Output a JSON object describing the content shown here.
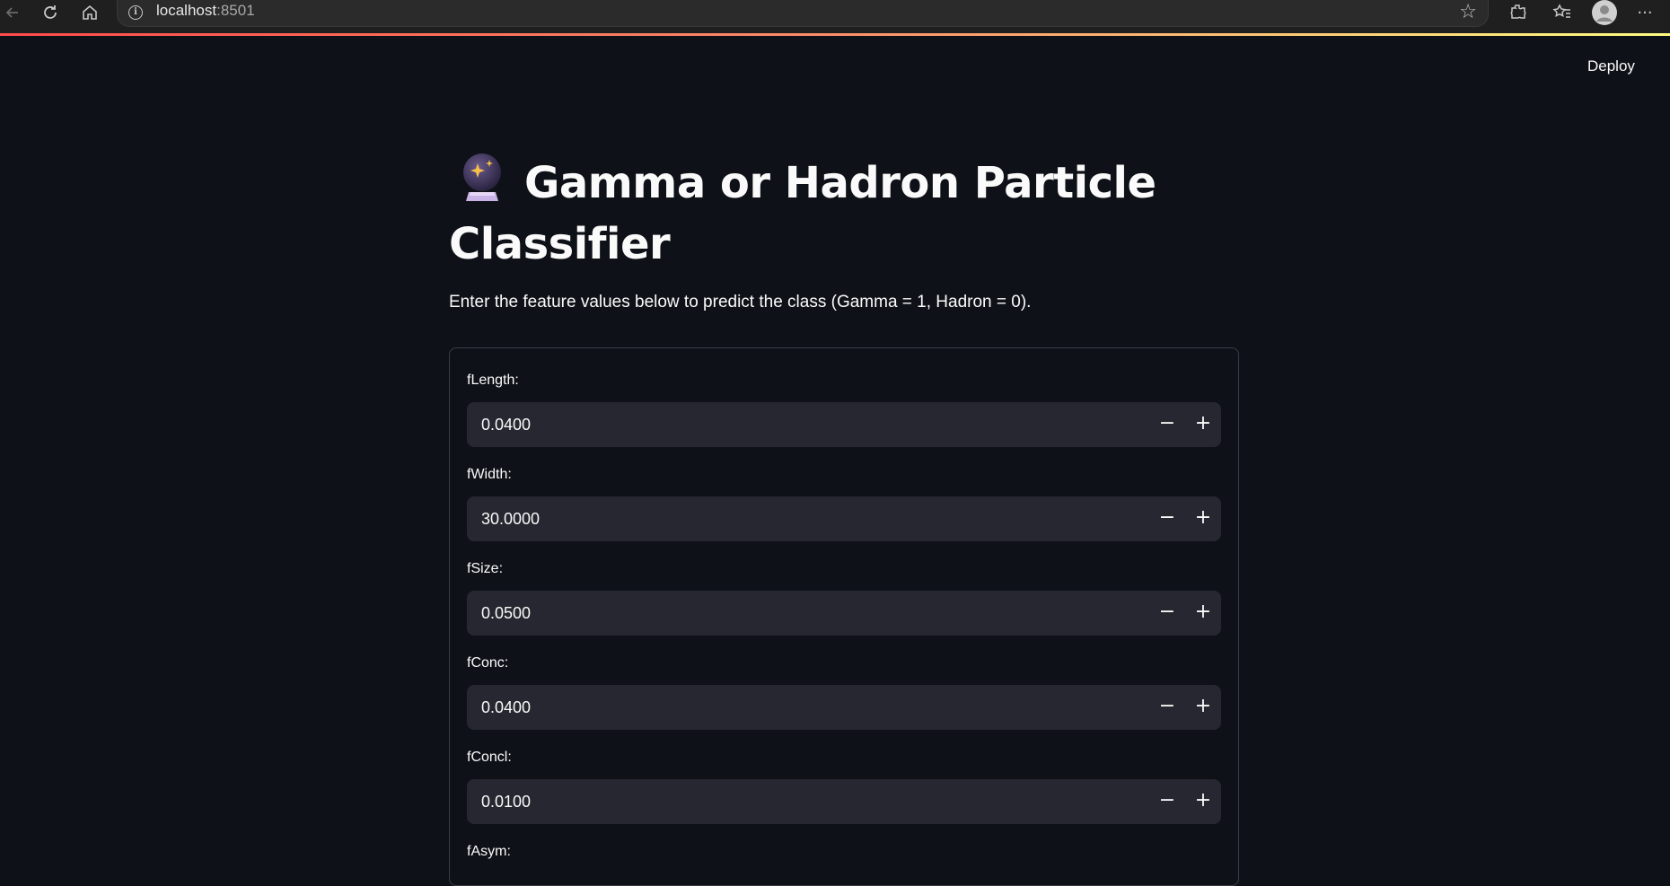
{
  "browser": {
    "url_host": "localhost",
    "url_port": ":8501"
  },
  "header": {
    "deploy_label": "Deploy",
    "menu_icon": "more-vert-icon"
  },
  "main": {
    "title_line1": "Gamma or Hadron Particle",
    "title_line2": "Classifier",
    "title_icon": "crystal-ball-icon",
    "subtitle": "Enter the feature values below to predict the class (Gamma = 1, Hadron = 0)."
  },
  "form": {
    "fields": [
      {
        "label": "fLength:",
        "value": "0.0400"
      },
      {
        "label": "fWidth:",
        "value": "30.0000"
      },
      {
        "label": "fSize:",
        "value": "0.0500"
      },
      {
        "label": "fConc:",
        "value": "0.0400"
      },
      {
        "label": "fConcl:",
        "value": "0.0100"
      },
      {
        "label": "fAsym:",
        "value": ""
      }
    ],
    "minus_label": "−",
    "plus_label": "+"
  }
}
